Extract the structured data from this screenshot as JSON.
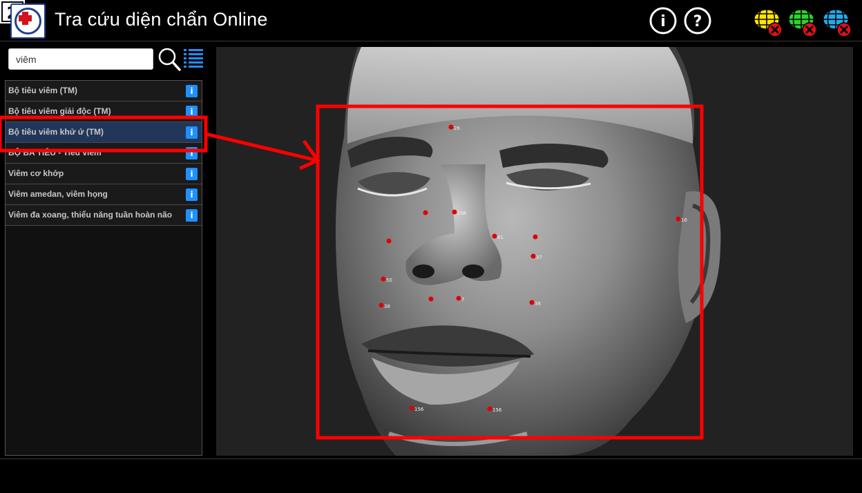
{
  "header": {
    "title": "Tra cứu diện chẩn Online",
    "info_icon": "info-circle-icon",
    "help_icon": "question-circle-icon",
    "number_badge": "2",
    "globes": [
      {
        "icon": "globe-yellow-disconnected-icon",
        "color": "#ffe400"
      },
      {
        "icon": "globe-green-disconnected-icon",
        "color": "#2ed12e"
      },
      {
        "icon": "globe-blue-disconnected-icon",
        "color": "#28a8e8"
      }
    ]
  },
  "search": {
    "value": "viêm",
    "search_icon": "magnifier-icon",
    "list_icon": "list-view-icon"
  },
  "results": [
    {
      "label": "Bộ tiêu viêm (TM)",
      "info": "i"
    },
    {
      "label": "Bộ tiêu viêm giải độc (TM)",
      "info": "i"
    },
    {
      "label": "Bộ tiêu viêm khử ứ (TM)",
      "info": "i",
      "selected": true
    },
    {
      "label": "BỘ BA TIÊU - Tiêu viêm",
      "info": "i"
    },
    {
      "label": "Viêm cơ khớp",
      "info": "i"
    },
    {
      "label": "Viêm amedan, viêm họng",
      "info": "i"
    },
    {
      "label": "Viêm đa xoang, thiểu năng tuần hoàn não",
      "info": "i"
    }
  ],
  "face_points": [
    {
      "label": "26"
    },
    {
      "label": "196"
    },
    {
      "label": "61"
    },
    {
      "label": "37"
    },
    {
      "label": "16"
    },
    {
      "label": "50"
    },
    {
      "label": "7"
    },
    {
      "label": "38"
    },
    {
      "label": "38"
    },
    {
      "label": "156"
    },
    {
      "label": "156"
    }
  ],
  "colors": {
    "accent_selection": "#22365a",
    "info_button": "#1e90ff",
    "highlight": "#ff0000",
    "acupoint": "#e00000"
  }
}
